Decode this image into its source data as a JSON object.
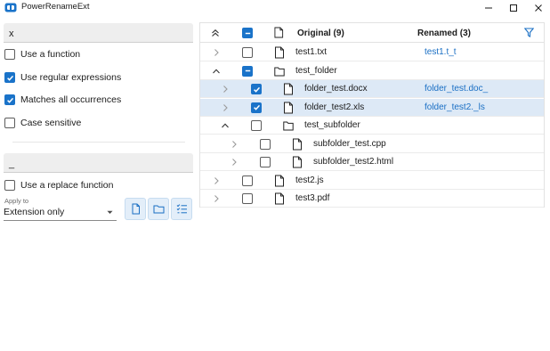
{
  "window": {
    "title": "PowerRenameExt",
    "accent_color": "#1a73c9",
    "link_color": "#1a6fc4",
    "selection_color": "#dde9f6",
    "controls": [
      "minimize-icon",
      "maximize-icon",
      "close-icon"
    ]
  },
  "search": {
    "value": "x"
  },
  "options": [
    {
      "label": "Use a function",
      "checked": false
    },
    {
      "label": "Use regular expressions",
      "checked": true
    },
    {
      "label": "Matches all occurrences",
      "checked": true
    },
    {
      "label": "Case sensitive",
      "checked": false
    }
  ],
  "replace": {
    "value": "_"
  },
  "replace_option": {
    "label": "Use a replace function",
    "checked": false
  },
  "apply_to": {
    "label": "Apply to",
    "selected": "Extension only"
  },
  "tool_buttons": [
    "file-icon",
    "folder-icon",
    "checklist-icon"
  ],
  "table": {
    "header": {
      "original": "Original (9)",
      "renamed": "Renamed (3)"
    },
    "rows": [
      {
        "name": "test1.txt",
        "renamed": "test1.t_t",
        "type": "file",
        "level": 0,
        "expander": "right",
        "checked": false,
        "selected": false
      },
      {
        "name": "test_folder",
        "renamed": "",
        "type": "folder",
        "level": 0,
        "expander": "up",
        "checked": "partial",
        "selected": false
      },
      {
        "name": "folder_test.docx",
        "renamed": "folder_test.doc_",
        "type": "file",
        "level": 1,
        "expander": "right",
        "checked": true,
        "selected": true
      },
      {
        "name": "folder_test2.xls",
        "renamed": "folder_test2._ls",
        "type": "file",
        "level": 1,
        "expander": "right",
        "checked": true,
        "selected": true
      },
      {
        "name": "test_subfolder",
        "renamed": "",
        "type": "folder",
        "level": 1,
        "expander": "up",
        "checked": false,
        "selected": false
      },
      {
        "name": "subfolder_test.cpp",
        "renamed": "",
        "type": "file",
        "level": 2,
        "expander": "right",
        "checked": false,
        "selected": false
      },
      {
        "name": "subfolder_test2.html",
        "renamed": "",
        "type": "file",
        "level": 2,
        "expander": "right",
        "checked": false,
        "selected": false
      },
      {
        "name": "test2.js",
        "renamed": "",
        "type": "file",
        "level": 0,
        "expander": "right",
        "checked": false,
        "selected": false
      },
      {
        "name": "test3.pdf",
        "renamed": "",
        "type": "file",
        "level": 0,
        "expander": "right",
        "checked": false,
        "selected": false
      }
    ]
  }
}
